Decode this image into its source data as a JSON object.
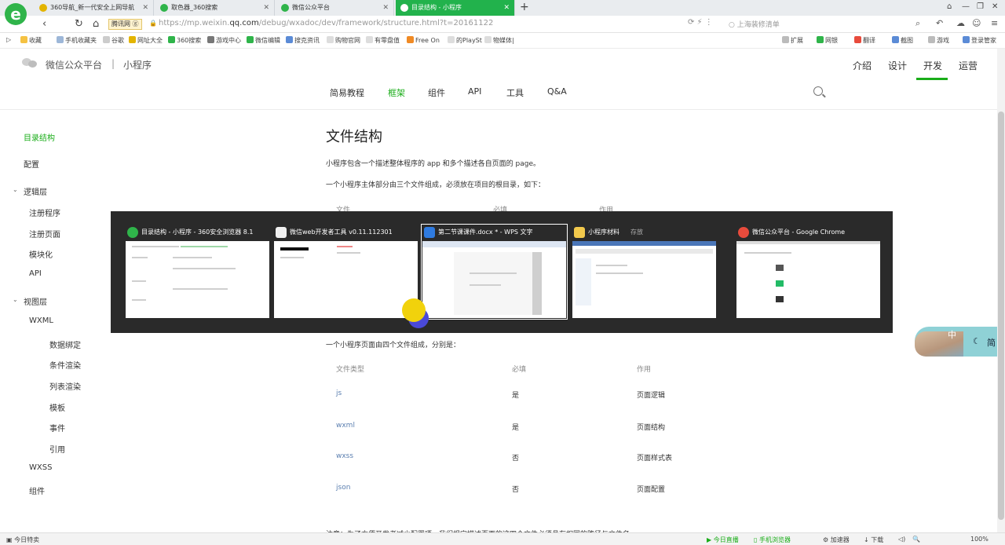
{
  "browser": {
    "tabs": [
      {
        "label": "360导航_新一代安全上网导航",
        "color": "#e3b400"
      },
      {
        "label": "取色器_360搜索",
        "color": "#2fb44a"
      },
      {
        "label": "微信公众平台",
        "color": "#2fb44a"
      },
      {
        "label": "目录结构 - 小程序",
        "color": "#ffffff"
      }
    ],
    "url_badge": "腾讯网 ⓖ",
    "url_prefix": "https://",
    "url_domain_pre": "mp.weixin.",
    "url_domain": "qq.com",
    "url_path": "/debug/wxadoc/dev/framework/structure.html?t=20161122",
    "search_hint": "上海装修清单",
    "bookmarks": [
      "收藏",
      "手机收藏夹",
      "谷歌",
      "网址大全",
      "360搜索",
      "游戏中心",
      "微信编辑",
      "搜克资讯",
      "购物官网",
      "有零盘值",
      "Free On",
      "的PlaySt",
      "物媒体|"
    ],
    "bookmarks_right": [
      "扩展",
      "网银",
      "翻译",
      "截图",
      "游戏",
      "登录管家"
    ]
  },
  "site": {
    "title": "微信公众平台",
    "sep": "|",
    "sub": "小程序",
    "topnav": [
      "介绍",
      "设计",
      "开发",
      "运营"
    ],
    "subnav": [
      "简易教程",
      "框架",
      "组件",
      "API",
      "工具",
      "Q&A"
    ]
  },
  "sidebar": {
    "items": [
      "目录结构",
      "配置"
    ],
    "logic_group": "逻辑层",
    "logic_items": [
      "注册程序",
      "注册页面",
      "模块化",
      "API"
    ],
    "view_group": "视图层",
    "wxml": "WXML",
    "wxml_items": [
      "数据绑定",
      "条件渲染",
      "列表渲染",
      "模板",
      "事件",
      "引用"
    ],
    "wxss": "WXSS",
    "component": "组件"
  },
  "content": {
    "title": "文件结构",
    "p1": "小程序包含一个描述整体程序的 app 和多个描述各自页面的 page。",
    "p2": "一个小程序主体部分由三个文件组成，必须放在项目的根目录，如下：",
    "top_headers": [
      "文件",
      "必填",
      "作用"
    ],
    "p3": "一个小程序页面由四个文件组成，分别是：",
    "headers": [
      "文件类型",
      "必填",
      "作用"
    ],
    "rows": [
      {
        "type": "js",
        "required": "是",
        "use": "页面逻辑"
      },
      {
        "type": "wxml",
        "required": "是",
        "use": "页面结构"
      },
      {
        "type": "wxss",
        "required": "否",
        "use": "页面样式表"
      },
      {
        "type": "json",
        "required": "否",
        "use": "页面配置"
      }
    ],
    "footnote": "注意：为了方便开发者减少配置项，我们规定描述页面的这四个文件必须具有相同的路径与文件名。"
  },
  "switcher": {
    "windows": [
      {
        "title": "目录结构 - 小程序 - 360安全浏览器 8.1",
        "icon_color": "#2fb44a"
      },
      {
        "title": "微信web开发者工具 v0.11.112301",
        "icon_color": "#f0f0f0"
      },
      {
        "title": "第二节课课件.docx * - WPS 文字",
        "icon_color": "#2f7be0"
      },
      {
        "title": "小程序材料",
        "icon_color": "#f2c94c"
      },
      {
        "title": "微信公众平台 - Google Chrome",
        "icon_color": "#e84b3c"
      }
    ],
    "partial_label": "存放"
  },
  "ime": {
    "mode": "中",
    "variant": "简"
  },
  "statusbar": {
    "left": "今日特卖",
    "right": [
      "今日直播",
      "手机浏览器",
      "加速器",
      "下载",
      "100%"
    ]
  }
}
